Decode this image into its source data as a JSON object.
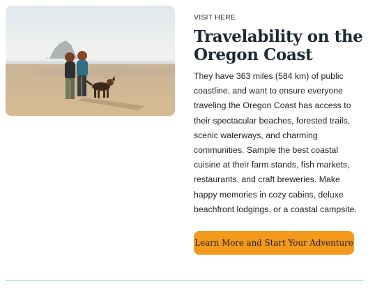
{
  "card": {
    "eyebrow": "VISIT HERE",
    "title": "Travelability on the Oregon Coast",
    "body": "They have 363 miles (584 km) of public coastline, and want to ensure everyone traveling the Oregon Coast has access to their spectacular beaches, forested trails, scenic waterways, and charming communities. Sample the best coastal cuisine at their farm stands, fish markets, restaurants, and craft breweries. Make happy memories in cozy cabins, deluxe beachfront lodgings, or a coastal campsite.",
    "cta_label": "Learn More and Start Your Adventure",
    "image": "beach-photo-two-women-walking-dog"
  },
  "colors": {
    "accent": "#f39a1d",
    "title": "#1b2a33",
    "divider": "#8fcfc8"
  }
}
